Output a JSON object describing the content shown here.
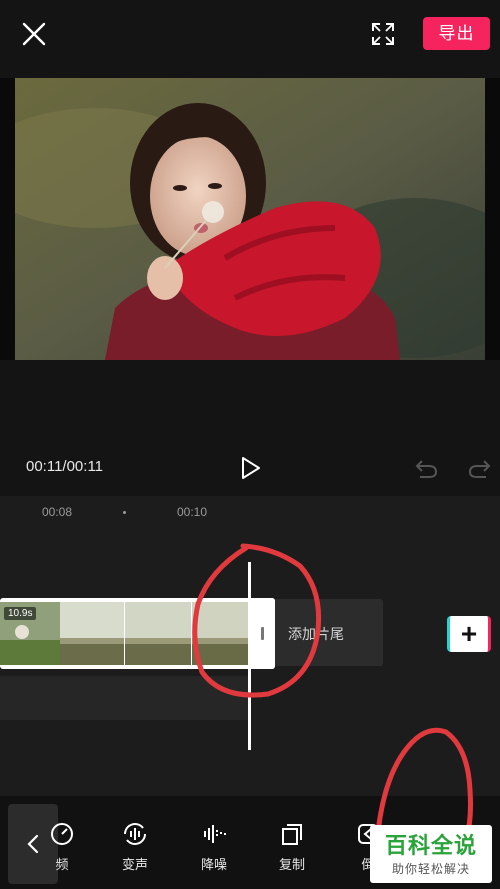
{
  "header": {
    "close_icon": "close-icon",
    "fullscreen_icon": "fullscreen-icon",
    "export_label": "导出"
  },
  "player": {
    "time": "00:11/00:11",
    "play_icon": "play-icon",
    "undo_icon": "undo-icon",
    "redo_icon": "redo-icon"
  },
  "timeline": {
    "ruler": [
      "00:08",
      "00:10"
    ],
    "clip_duration": "10.9s",
    "add_ending_label": "添加片尾",
    "add_clip_icon": "plus-icon"
  },
  "toolbar": {
    "back_icon": "chevron-left-icon",
    "items": [
      {
        "label": "频",
        "icon": "speed-icon"
      },
      {
        "label": "变声",
        "icon": "voice-change-icon"
      },
      {
        "label": "降噪",
        "icon": "noise-reduction-icon"
      },
      {
        "label": "复制",
        "icon": "copy-icon"
      },
      {
        "label": "倒",
        "icon": "reverse-icon"
      }
    ]
  },
  "watermark": {
    "main": "百科全说",
    "sub": "助你轻松解决"
  },
  "colors": {
    "accent": "#f5245f",
    "teal": "#25d4d0",
    "annotation": "#e0393e",
    "watermark_green": "#2aa43a"
  }
}
